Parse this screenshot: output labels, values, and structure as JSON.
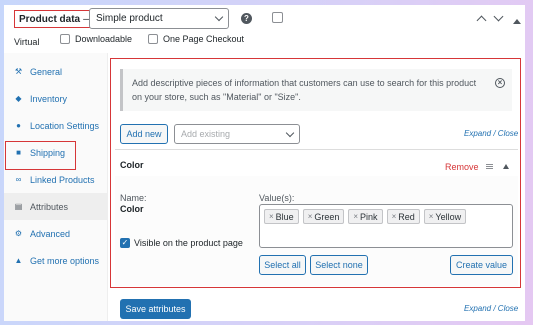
{
  "header": {
    "product_data_label": "Product data",
    "product_data_dash": "—",
    "product_type": "Simple product",
    "help_symbol": "?"
  },
  "options": {
    "virtual": "Virtual",
    "downloadable": "Downloadable",
    "one_page_checkout": "One Page Checkout"
  },
  "sidebar": {
    "items": [
      {
        "label": "General",
        "icon": "wrench-icon"
      },
      {
        "label": "Inventory",
        "icon": "tag-icon"
      },
      {
        "label": "Location Settings",
        "icon": "location-icon"
      },
      {
        "label": "Shipping",
        "icon": "truck-icon"
      },
      {
        "label": "Linked Products",
        "icon": "link-icon"
      },
      {
        "label": "Attributes",
        "icon": "table-icon"
      },
      {
        "label": "Advanced",
        "icon": "gear-icon"
      },
      {
        "label": "Get more options",
        "icon": "plugin-icon"
      }
    ],
    "active_index": 5
  },
  "notice": {
    "text": "Add descriptive pieces of information that customers can use to search for this product on your store, such as \"Material\" or \"Size\"."
  },
  "toolbar": {
    "add_new": "Add new",
    "add_existing_placeholder": "Add existing",
    "expand_close": "Expand / Close"
  },
  "attribute": {
    "title": "Color",
    "remove": "Remove",
    "name_label": "Name:",
    "name_value": "Color",
    "values_label": "Value(s):",
    "values": [
      "Blue",
      "Green",
      "Pink",
      "Red",
      "Yellow"
    ],
    "visible_label": "Visible on the product page",
    "visible_checked": true,
    "select_all": "Select all",
    "select_none": "Select none",
    "create_value": "Create value"
  },
  "footer": {
    "save_attributes": "Save attributes",
    "expand_close": "Expand / Close"
  },
  "colors": {
    "accent": "#2271b1",
    "highlight_outline": "#d63638",
    "remove_link": "#d63638"
  }
}
